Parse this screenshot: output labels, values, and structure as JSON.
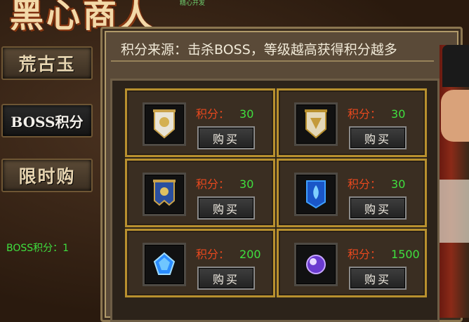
{
  "window": {
    "title": "黑心商人",
    "subtitle": "精心开发"
  },
  "sidebar": {
    "items": [
      {
        "label": "荒古玉",
        "active": false
      },
      {
        "label": "BOSS积分",
        "active": true
      },
      {
        "label": "限时购",
        "active": false
      }
    ],
    "boss_points_label": "BOSS积分：1"
  },
  "main": {
    "source_text": "积分来源：击杀BOSS，等级越高获得积分越多",
    "items": [
      {
        "icon": "white-banner-icon",
        "score_label": "积分：",
        "score": "30",
        "buy_label": "购买"
      },
      {
        "icon": "gold-banner-icon",
        "score_label": "积分：",
        "score": "30",
        "buy_label": "购买"
      },
      {
        "icon": "blue-dragon-banner-icon",
        "score_label": "积分：",
        "score": "30",
        "buy_label": "购买"
      },
      {
        "icon": "blue-flame-banner-icon",
        "score_label": "积分：",
        "score": "30",
        "buy_label": "购买"
      },
      {
        "icon": "blue-gem-icon",
        "score_label": "积分：",
        "score": "200",
        "buy_label": "购买"
      },
      {
        "icon": "purple-orb-icon",
        "score_label": "积分：",
        "score": "1500",
        "buy_label": "购买"
      }
    ]
  },
  "colors": {
    "score_label": "#e8481e",
    "score_value": "#3fe03f",
    "cell_border": "#b8902e"
  }
}
